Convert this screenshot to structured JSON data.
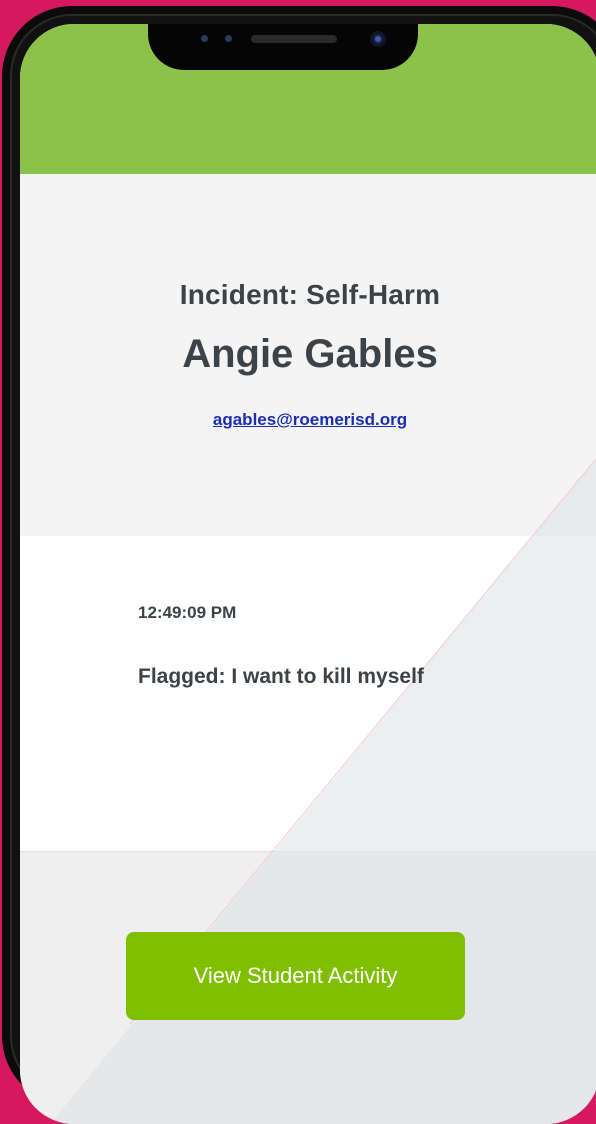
{
  "incident": {
    "title": "Incident: Self-Harm",
    "student_name": "Angie Gables",
    "student_email": "agables@roemerisd.org"
  },
  "message": {
    "timestamp": "12:49:09 PM",
    "flagged_label": "Flagged:",
    "flagged_text": "I want to kill myself"
  },
  "actions": {
    "view_activity_label": "View Student Activity"
  },
  "colors": {
    "background": "#d6195f",
    "header_green": "#8bc34a",
    "button_green": "#7fbf00",
    "text_dark": "#3b4348",
    "link_blue": "#1d2db0"
  }
}
